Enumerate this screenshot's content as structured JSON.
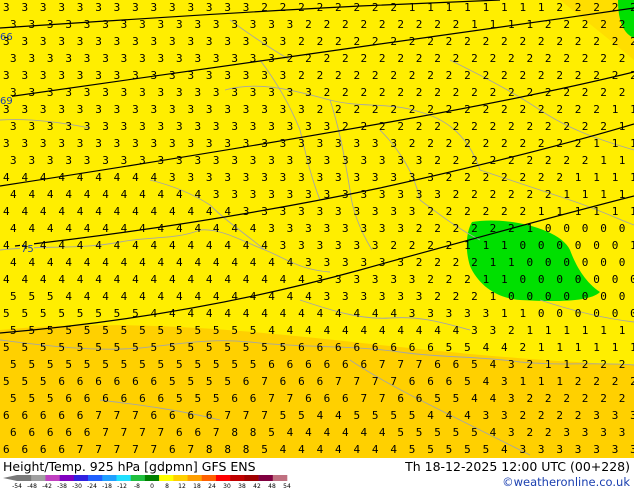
{
  "title": {
    "left": "Height/Temp. 925 hPa [gdpmn] GFS ENS",
    "right": "Th 18-12-2025 12:00 UTC (00+228)"
  },
  "credit": "©weatheronline.co.uk",
  "legend": {
    "ticks": [
      "-54",
      "-48",
      "-42",
      "-38",
      "-30",
      "-24",
      "-18",
      "-12",
      "-8",
      "0",
      "8",
      "12",
      "18",
      "24",
      "30",
      "38",
      "42",
      "48",
      "54"
    ],
    "colors": [
      "#7a7a7a",
      "#a0a0a0",
      "#c040c0",
      "#8000c0",
      "#3020e0",
      "#2060ff",
      "#20a0ff",
      "#20e0ff",
      "#20c040",
      "#008000",
      "#ffff00",
      "#ffd000",
      "#ffa000",
      "#ff6000",
      "#ff0000",
      "#c00000",
      "#a00000",
      "#800040",
      "#c07080"
    ]
  },
  "contour_labels": [
    "66",
    "69",
    "75"
  ],
  "colors": {
    "field_yellow": "#ffee00",
    "field_orange": "#ffd000",
    "zero_band_green": "#00e000",
    "border_grey": "#a6a6a6",
    "contour_black": "#000000"
  },
  "digit_rows": [
    "3 3 3 3 3 3 3 3 3 3 3 3 3 3 2 2 2 2 2 2 2 2 1 1 1 1 1 1 1 1 2 2 2 2 2 2 1 1 1 0",
    "3 3 3 3 3 3 3 3 3 3 3 3 3 3 3 3 2 2 2 2 2 2 2 2 2 1 1 1 1 2 2 2 2 2 2 2 1 1 1 0",
    "3 3 3 3 3 3 3 3 3 3 3 3 3 3 3 3 2 2 2 2 2 2 2 2 2 2 2 2 2 2 2 2 2 2 2 2 2 1 1 1",
    "3 3 3 3 3 3 3 3 3 3 3 3 3 3 3 2 2 2 2 2 2 2 2 2 2 2 2 2 2 2 2 2 2 2 2 2 2 1 1 1",
    "3 3 3 3 3 3 3 3 3 3 3 3 3 3 3 3 2 2 2 2 2 2 2 2 2 2 2 2 2 2 2 2 2 2 2 1 1 1 1 1",
    "3 3 3 3 3 3 3 3 3 3 3 3 3 3 3 3 3 2 2 2 2 2 2 2 2 2 2 2 2 2 2 2 2 2 1 1 1 1 1 1",
    "3 3 3 3 3 3 3 3 3 3 3 3 3 3 3 3 3 2 2 2 2 2 2 2 2 2 2 2 2 2 2 2 2 1 1 1 1 1 1 1",
    "3 3 3 3 3 3 3 3 3 3 3 3 3 3 3 3 3 3 2 2 2 2 2 2 2 2 2 2 2 2 2 2 2 1 1 1 1 1 1 1",
    "3 3 3 3 3 3 3 3 3 3 3 3 3 3 3 3 3 3 3 3 3 3 2 2 2 2 2 2 2 2 2 2 1 1 1 1 1 1 1 1",
    "3 3 3 3 3 3 3 3 3 3 3 3 3 3 3 3 3 3 3 3 3 3 3 2 2 2 2 2 2 2 2 2 1 1 1 1 1 1 1 1",
    "4 4 4 4 4 4 4 4 4 3 3 3 3 3 3 3 3 3 3 3 3 3 3 3 2 2 2 2 2 2 2 1 1 1 1 1 1 1 1 1",
    "4 4 4 4 4 4 4 4 4 4 4 3 3 3 3 3 3 3 3 3 3 3 3 3 2 2 2 2 2 2 1 1 1 1 1 1 1 1 1 1",
    "4 4 4 4 4 4 4 4 4 4 4 4 4 3 3 3 3 3 3 3 3 3 3 2 2 2 2 2 2 1 1 1 1 1 1 1 1 1 1 1",
    "4 4 4 4 4 4 4 4 4 4 4 4 4 4 3 3 3 3 3 3 3 3 2 2 2 2 2 2 1 0 0 0 0 0 1 1 1 2 2 2",
    "4 4 4 4 4 4 4 4 4 4 4 4 4 4 4 3 3 3 3 3 3 2 2 2 2 1 1 1 0 0 0 0 0 0 1 1 1 1 2 2",
    "4 4 4 4 4 4 4 4 4 4 4 4 4 4 4 4 3 3 3 3 3 3 2 2 2 2 1 1 0 0 0 0 0 0 0 1 1 1 2 2",
    "4 4 4 4 4 4 4 4 4 4 4 4 4 4 4 4 4 3 3 3 3 3 3 2 2 2 1 1 0 0 0 0 0 0 0 0 1 1 1 2",
    "5 5 5 4 4 4 4 4 4 4 4 4 4 4 4 4 4 3 3 3 3 3 3 2 2 2 1 0 0 0 0 0 0 0 0 0 0 0 1 2",
    "5 5 5 5 5 5 5 5 4 4 4 4 4 4 4 4 4 4 4 4 4 4 3 3 3 3 3 1 1 0 0 0 0 0 0 0 0 0 0 0",
    "5 5 5 5 5 5 5 5 5 5 5 5 5 5 4 4 4 4 4 4 4 4 4 4 4 3 3 2 1 1 1 1 1 1 1 1 1 1 1 1",
    "5 5 5 5 5 5 5 5 5 5 5 5 5 5 5 5 6 6 6 6 6 6 6 6 5 5 4 4 2 1 1 1 1 1 1 1 2 2 2 2",
    "5 5 5 5 5 5 5 5 5 5 5 5 5 5 6 6 6 6 6 6 7 7 7 6 6 5 4 3 2 1 1 2 2 2 2 2 2 2 2 2",
    "5 5 5 6 6 6 6 6 6 5 5 5 5 6 7 6 6 6 7 7 7 7 6 6 6 5 4 3 1 1 1 2 2 2 2 2 2 2 2 2",
    "5 5 5 6 6 6 6 6 6 5 5 5 6 6 7 7 6 6 6 7 7 6 6 5 5 4 4 3 2 2 2 2 2 2 2 2 2 3 3 3",
    "6 6 6 6 6 7 7 7 6 6 6 6 7 7 7 5 5 4 4 5 5 5 5 4 4 4 3 3 2 2 2 2 3 3 3 3 3 3 3 3",
    "6 6 6 6 6 7 7 7 7 6 6 7 8 8 5 4 4 4 4 4 4 5 5 5 5 5 4 3 2 2 3 3 3 3 3 3 3 3 3 3",
    "6 6 6 6 7 7 7 7 7 6 7 8 8 8 5 4 4 4 4 4 4 4 5 5 5 5 5 4 3 3 3 3 3 3 3 3 3 3 3 3"
  ]
}
